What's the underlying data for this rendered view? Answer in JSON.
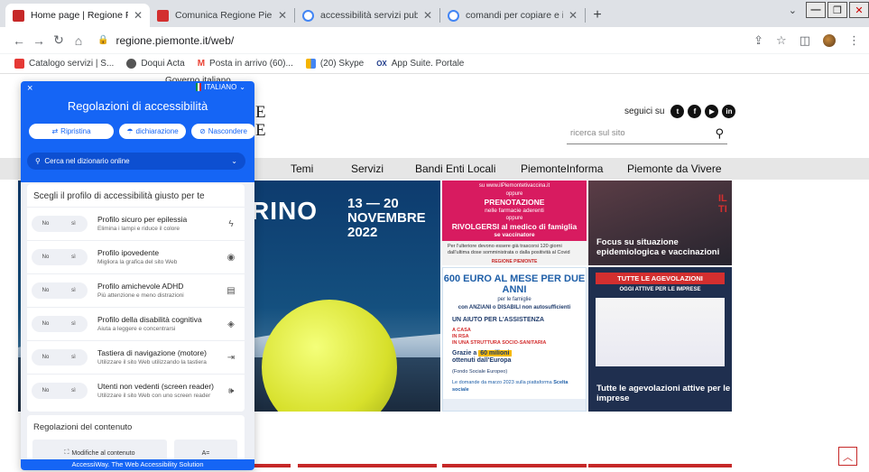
{
  "browser": {
    "tabs": [
      {
        "title": "Home page | Regione Piemonte",
        "favicon_color": "#c62828",
        "active": true
      },
      {
        "title": "Comunica Regione Piemonte",
        "favicon_color": "#d32f2f",
        "active": false
      },
      {
        "title": "accessibilità servizi pubblici - Cer",
        "favicon_color": "#4285f4",
        "active": false
      },
      {
        "title": "comandi per copiare e incollare",
        "favicon_color": "#4285f4",
        "active": false
      }
    ],
    "new_tab": "+",
    "url": "regione.piemonte.it/web/",
    "bookmarks": [
      {
        "label": "Catalogo servizi | S...",
        "color": "#e53935"
      },
      {
        "label": "Doqui Acta",
        "color": "#555555"
      },
      {
        "label": "Posta in arrivo (60)...",
        "color": "#ea4335"
      },
      {
        "label": "(20) Skype",
        "color": "#f4b400"
      },
      {
        "label": "App Suite. Portale",
        "color": "#1f3b8a"
      }
    ],
    "bookmark_prefix_ox": "OX",
    "bookmark_prefix_m": "M"
  },
  "site": {
    "gov_label": "Governo italiano",
    "logo_letters": [
      "E",
      "E"
    ],
    "follow_label": "seguici su",
    "social": [
      "t",
      "f",
      "▶",
      "in"
    ],
    "search_placeholder": "ricerca sul sito",
    "nav": [
      "Temi",
      "Servizi",
      "Bandi Enti Locali",
      "PiemonteInforma",
      "Piemonte da Vivere"
    ],
    "hero": {
      "big_text": "RINO",
      "dates_line1": "13 — 20",
      "dates_line2": "NOVEMBRE",
      "dates_line3": "2022"
    },
    "card_vaccine": {
      "url_line": "su www.ilPiemontetivaccina.it",
      "line1": "oppure",
      "line2": "PRENOTAZIONE",
      "line3": "nelle farmacie aderenti",
      "line4": "oppure",
      "line5": "RIVOLGERSI al medico di famiglia",
      "line6": "se vaccinatore",
      "note": "Per l'ulteriore devono essere già trascorsi 120 giorni dall'ultima dose somministrata o dalla positività al Covid",
      "footer": "REGIONE PIEMONTE"
    },
    "card_focus": {
      "caption": "Focus su situazione epidemiologica e vaccinazioni",
      "corner": "IL TI"
    },
    "card_600": {
      "head": "600 EURO AL MESE PER DUE ANNI",
      "line1": "per le famiglie",
      "line2": "con ANZIANI o DISABILI non autosufficienti",
      "line3": "UN AIUTO PER L'ASSISTENZA",
      "bullets": [
        "A CASA",
        "IN RSA",
        "IN UNA STRUTTURA SOCIO-SANITARIA"
      ],
      "grazie_pre": "Grazie a",
      "grazie_hi": "60 milioni",
      "grazie_post": "ottenuti dall'Europa",
      "fund": "(Fondo Sociale Europeo)",
      "domande": "Le domande da marzo 2023 sulla piattaforma",
      "sportello": "Scelta sociale"
    },
    "card_agev": {
      "tag": "TUTTE LE AGEVOLAZIONI",
      "sub": "OGGI ATTIVE PER LE IMPRESE",
      "caption": "Tutte le agevolazioni attive per le imprese"
    },
    "scroll_top_icon": "chevron-up"
  },
  "a11y": {
    "close": "×",
    "language": "ITALIANO",
    "title": "Regolazioni di accessibilità",
    "buttons": [
      {
        "label": "Ripristina",
        "icon": "⇄"
      },
      {
        "label": "dichiarazione",
        "icon": "☂"
      },
      {
        "label": "Nascondere",
        "icon": "⊘"
      }
    ],
    "dictionary": "Cerca nel dizionario online",
    "profiles_title": "Scegli il profilo di accessibilità giusto per te",
    "toggle_no": "No",
    "toggle_si": "sì",
    "profiles": [
      {
        "name": "Profilo sicuro per epilessia",
        "desc": "Elimina i lampi e riduce il colore",
        "icon": "ϟ"
      },
      {
        "name": "Profilo ipovedente",
        "desc": "Migliora la grafica del sito Web",
        "icon": "◉"
      },
      {
        "name": "Profilo amichevole ADHD",
        "desc": "Più attenzione e meno distrazioni",
        "icon": "▤"
      },
      {
        "name": "Profilo della disabilità cognitiva",
        "desc": "Aiuta a leggere e concentrarsi",
        "icon": "◈"
      },
      {
        "name": "Tastiera di navigazione (motore)",
        "desc": "Utilizzare il sito Web utilizzando la tastiera",
        "icon": "⇥"
      },
      {
        "name": "Utenti non vedenti (screen reader)",
        "desc": "Utilizzare il sito Web con uno screen reader",
        "icon": "🕪"
      }
    ],
    "content_title": "Regolazioni del contenuto",
    "content_items": [
      "Modifiche al contenuto",
      "A="
    ],
    "footer": "AccessiWay. The Web Accessibility Solution"
  }
}
